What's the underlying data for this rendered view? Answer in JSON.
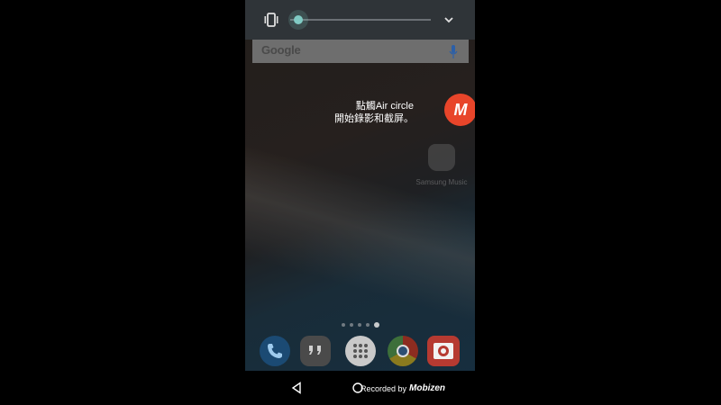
{
  "volume_panel": {
    "mode_icon": "vibrate-icon",
    "volume_level": 0.03,
    "expand_icon": "chevron-down-icon",
    "accent_color": "#80cbc4"
  },
  "search_bar": {
    "logo_text": "Google",
    "mic_icon": "mic-icon"
  },
  "tooltip": {
    "line1": "點觸Air circle",
    "line2": "開始錄影和截屏。"
  },
  "air_circle": {
    "glyph": "M",
    "color": "#e8452a"
  },
  "home_apps": [
    {
      "label": "Samsung Music",
      "icon": "music-icon"
    }
  ],
  "page_indicator": {
    "count": 5,
    "active_index": 4
  },
  "dock": [
    {
      "name": "Phone",
      "icon": "phone-icon"
    },
    {
      "name": "Hangouts",
      "icon": "hangouts-icon"
    },
    {
      "name": "Apps",
      "icon": "app-drawer-icon"
    },
    {
      "name": "Chrome",
      "icon": "chrome-icon"
    },
    {
      "name": "Camera",
      "icon": "camera-icon"
    }
  ],
  "navbar": {
    "back_icon": "back-icon",
    "home_icon": "home-icon",
    "recorded_by": "Recorded by",
    "brand": "Mobizen"
  }
}
